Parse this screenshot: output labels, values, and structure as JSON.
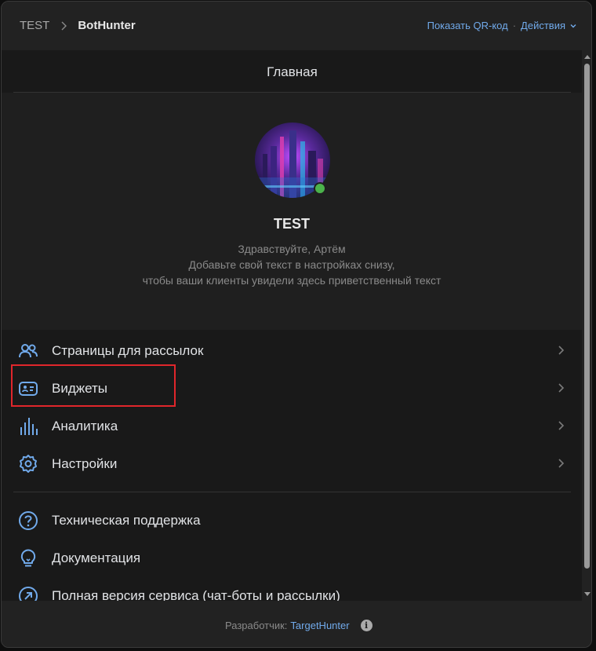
{
  "breadcrumb": {
    "root": "TEST",
    "current": "BotHunter"
  },
  "header_actions": {
    "qr": "Показать QR-код",
    "separator": "·",
    "actions": "Действия"
  },
  "page": {
    "title": "Главная"
  },
  "profile": {
    "name": "TEST",
    "online": true,
    "greeting": [
      "Здравствуйте, Артём",
      "Добавьте свой текст в настройках снизу,",
      "чтобы ваши клиенты увидели здесь приветственный текст"
    ]
  },
  "menu_main": [
    {
      "label": "Страницы для рассылок",
      "icon": "users-icon"
    },
    {
      "label": "Виджеты",
      "icon": "widget-card-icon"
    },
    {
      "label": "Аналитика",
      "icon": "analytics-bars-icon"
    },
    {
      "label": "Настройки",
      "icon": "gear-icon"
    }
  ],
  "menu_secondary": [
    {
      "label": "Техническая поддержка",
      "icon": "help-circle-icon"
    },
    {
      "label": "Документация",
      "icon": "lightbulb-icon"
    },
    {
      "label": "Полная версия сервиса (чат-боты и рассылки)",
      "icon": "external-arrow-icon"
    }
  ],
  "footer": {
    "prefix": "Разработчик:",
    "link": "TargetHunter",
    "info_glyph": "i"
  },
  "colors": {
    "accent": "#71aaeb",
    "highlight": "#e0262b",
    "online": "#4bb34b",
    "background": "#191919"
  }
}
